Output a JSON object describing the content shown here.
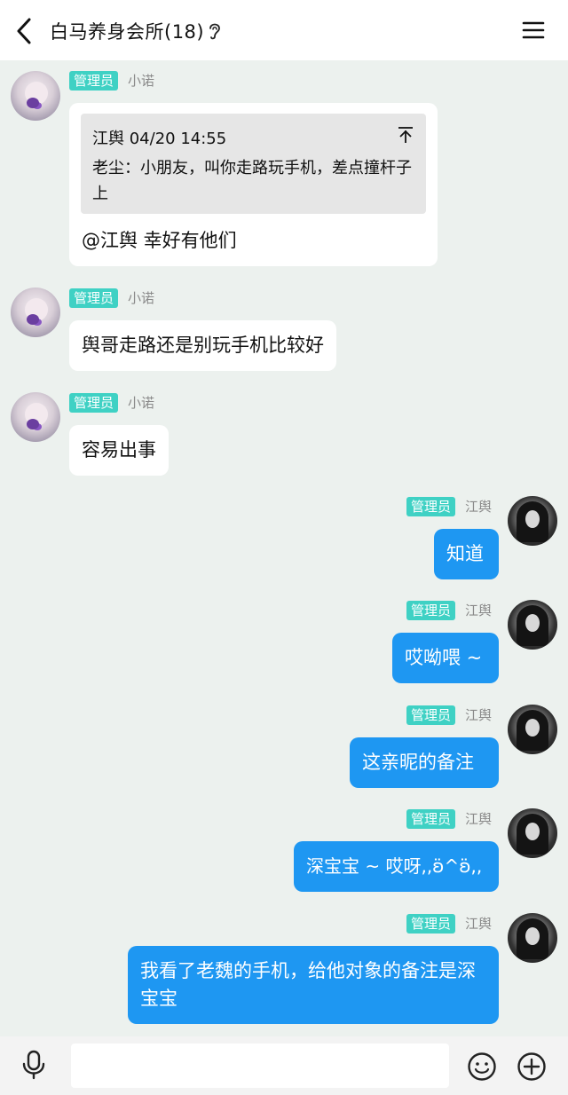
{
  "header": {
    "title": "白马养身会所(18)",
    "back_icon": "chevron-left-icon",
    "ear_icon": "ear-icon",
    "menu_icon": "hamburger-menu-icon"
  },
  "colors": {
    "background": "#ecf1ee",
    "self_bubble": "#1e97f2",
    "other_bubble": "#ffffff",
    "admin_badge": "#3fd1c4"
  },
  "messages": [
    {
      "side": "left",
      "badge": "管理员",
      "sender": "小诺",
      "quote": {
        "author_time": "江舆 04/20 14:55",
        "text": "老尘：小朋友，叫你走路玩手机，差点撞杆子上"
      },
      "text": "@江舆 幸好有他们"
    },
    {
      "side": "left",
      "badge": "管理员",
      "sender": "小诺",
      "text": "舆哥走路还是别玩手机比较好"
    },
    {
      "side": "left",
      "badge": "管理员",
      "sender": "小诺",
      "text": "容易出事"
    },
    {
      "side": "right",
      "badge": "管理员",
      "sender": "江舆",
      "text": "知道"
    },
    {
      "side": "right",
      "badge": "管理员",
      "sender": "江舆",
      "text": "哎呦喂 ~"
    },
    {
      "side": "right",
      "badge": "管理员",
      "sender": "江舆",
      "text": "这亲昵的备注"
    },
    {
      "side": "right",
      "badge": "管理员",
      "sender": "江舆",
      "text": "深宝宝 ~ 哎呀,,ʚ̈^ʚ̈,,"
    },
    {
      "side": "right",
      "badge": "管理员",
      "sender": "江舆",
      "text": "我看了老魏的手机，给他对象的备注是深宝宝"
    }
  ],
  "input_bar": {
    "value": "",
    "mic_icon": "microphone-icon",
    "emoji_icon": "smiley-icon",
    "plus_icon": "plus-circle-icon"
  }
}
